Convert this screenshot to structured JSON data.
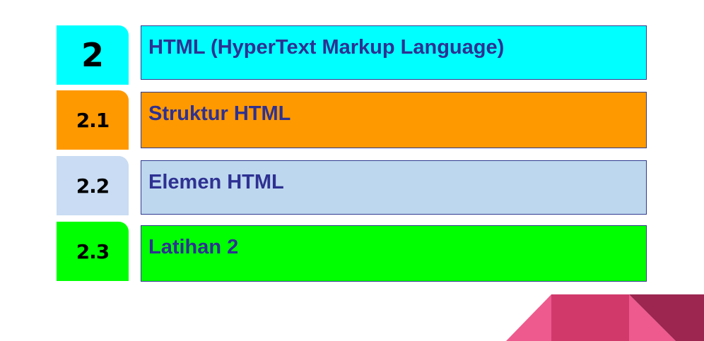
{
  "menu": {
    "items": [
      {
        "number": "2",
        "title": "HTML  (HyperText Markup Language)",
        "color": "#00ffff",
        "tab_color": "#00ffff"
      },
      {
        "number": "2.1",
        "title": "Struktur HTML",
        "color": "#ff9900",
        "tab_color": "#ff9900"
      },
      {
        "number": "2.2",
        "title": "Elemen HTML",
        "color": "#bdd7ee",
        "tab_color": "#c9dcf3"
      },
      {
        "number": "2.3",
        "title": "Latihan 2",
        "color": "#00ff00",
        "tab_color": "#00ff00"
      }
    ]
  },
  "colors": {
    "text": "#2e3192",
    "decor_pink": "#e85a8c",
    "decor_magenta": "#d1396b",
    "decor_dark": "#9c2650"
  }
}
